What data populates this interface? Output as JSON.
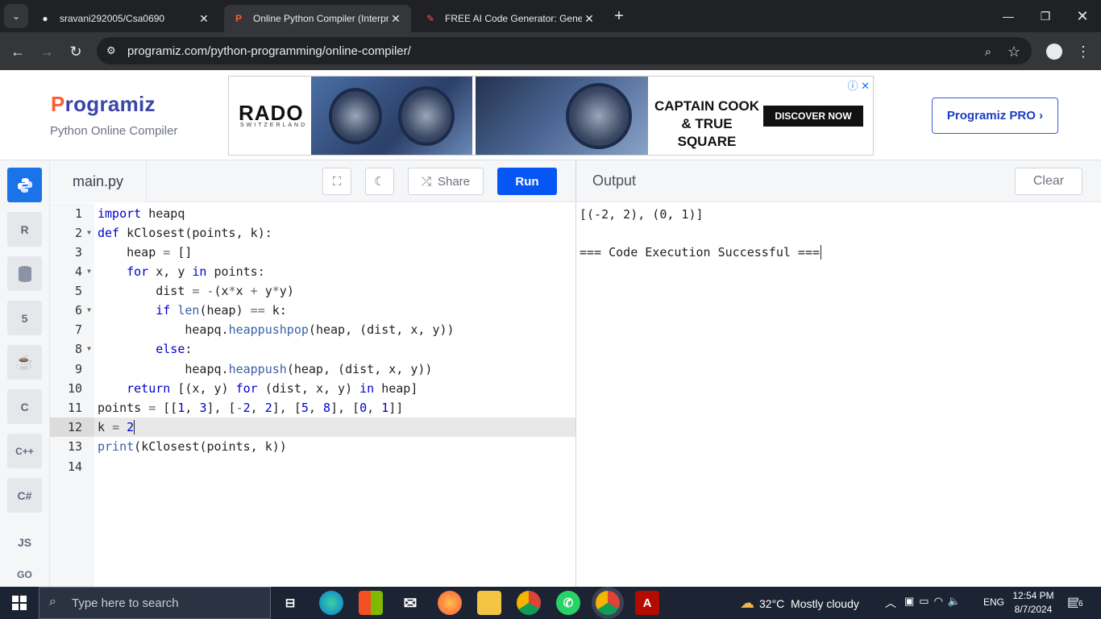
{
  "browser": {
    "tabs": [
      {
        "title": "sravani292005/Csa0690",
        "icon": "github-icon"
      },
      {
        "title": "Online Python Compiler (Interpr",
        "icon": "programiz-icon"
      },
      {
        "title": "FREE AI Code Generator: Genera",
        "icon": "ai-icon"
      }
    ],
    "url": "programiz.com/python-programming/online-compiler/"
  },
  "header": {
    "logo": "rogramiz",
    "logo_p": "P",
    "subtitle": "Python Online Compiler",
    "pro_button": "Programiz PRO ›"
  },
  "ad": {
    "brand": "RADO",
    "brand_sub": "SWITZERLAND",
    "headline": "CAPTAIN COOK & TRUE SQUARE",
    "cta": "DISCOVER NOW"
  },
  "sidebar": {
    "languages": [
      "python",
      "R",
      "sql",
      "html",
      "java",
      "C",
      "C++",
      "C#",
      "JS",
      "GO"
    ]
  },
  "editor": {
    "file_name": "main.py",
    "share_label": "Share",
    "run_label": "Run",
    "line_numbers": [
      "1",
      "2",
      "3",
      "4",
      "5",
      "6",
      "7",
      "8",
      "9",
      "10",
      "11",
      "12",
      "13",
      "14"
    ]
  },
  "output": {
    "title": "Output",
    "clear_label": "Clear",
    "lines": [
      "[(-2, 2), (0, 1)]",
      "",
      "=== Code Execution Successful ==="
    ]
  },
  "taskbar": {
    "search_placeholder": "Type here to search",
    "weather": "32°C  Mostly cloudy",
    "lang": "ENG",
    "time": "12:54 PM",
    "date": "8/7/2024",
    "notification_count": "6"
  }
}
